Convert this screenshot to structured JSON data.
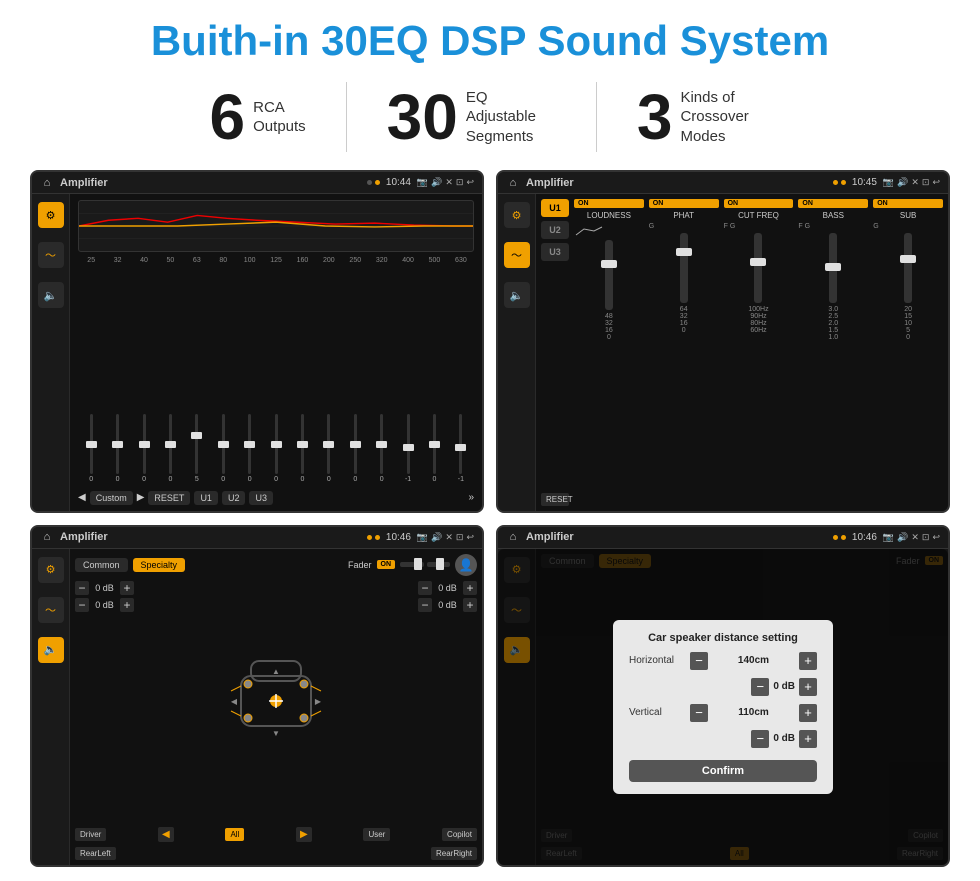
{
  "title": "Buith-in 30EQ DSP Sound System",
  "stats": [
    {
      "number": "6",
      "label": "RCA\nOutputs"
    },
    {
      "number": "30",
      "label": "EQ Adjustable\nSegments"
    },
    {
      "number": "3",
      "label": "Kinds of\nCrossover Modes"
    }
  ],
  "screens": [
    {
      "id": "eq-screen",
      "statusbar": {
        "appName": "Amplifier",
        "time": "10:44",
        "icons": [
          "▶"
        ]
      },
      "type": "eq"
    },
    {
      "id": "crossover-screen",
      "statusbar": {
        "appName": "Amplifier",
        "time": "10:45",
        "icons": [
          "■"
        ]
      },
      "type": "crossover"
    },
    {
      "id": "fader-screen",
      "statusbar": {
        "appName": "Amplifier",
        "time": "10:46",
        "icons": [
          "■"
        ]
      },
      "type": "fader"
    },
    {
      "id": "distance-screen",
      "statusbar": {
        "appName": "Amplifier",
        "time": "10:46",
        "icons": [
          "■"
        ]
      },
      "type": "distance-dialog"
    }
  ],
  "eq": {
    "frequencies": [
      "25",
      "32",
      "40",
      "50",
      "63",
      "80",
      "100",
      "125",
      "160",
      "200",
      "250",
      "320",
      "400",
      "500",
      "630"
    ],
    "values": [
      "0",
      "0",
      "0",
      "0",
      "5",
      "0",
      "0",
      "0",
      "0",
      "0",
      "0",
      "0",
      "-1",
      "0",
      "-1"
    ],
    "presetLabel": "Custom",
    "buttons": [
      "RESET",
      "U1",
      "U2",
      "U3"
    ]
  },
  "crossover": {
    "presets": [
      "U1",
      "U2",
      "U3"
    ],
    "columns": [
      "LOUDNESS",
      "PHAT",
      "CUT FREQ",
      "BASS",
      "SUB"
    ],
    "allOn": true,
    "resetLabel": "RESET"
  },
  "fader": {
    "tabs": [
      "Common",
      "Specialty"
    ],
    "activeTab": "Specialty",
    "faderLabel": "Fader",
    "onLabel": "ON",
    "dbValues": [
      "0 dB",
      "0 dB",
      "0 dB",
      "0 dB"
    ],
    "labels": {
      "driver": "Driver",
      "copilot": "Copilot",
      "rearLeft": "RearLeft",
      "rearRight": "RearRight",
      "all": "All",
      "user": "User"
    }
  },
  "dialog": {
    "title": "Car speaker distance setting",
    "horizontal": {
      "label": "Horizontal",
      "value": "140cm"
    },
    "vertical": {
      "label": "Vertical",
      "value": "110cm"
    },
    "confirmLabel": "Confirm",
    "dbRight": "0 dB",
    "dbRight2": "0 dB"
  },
  "colors": {
    "accent": "#f0a000",
    "blue": "#1a90d9",
    "dark": "#1a1a1a",
    "medium": "#2a2a2a"
  }
}
